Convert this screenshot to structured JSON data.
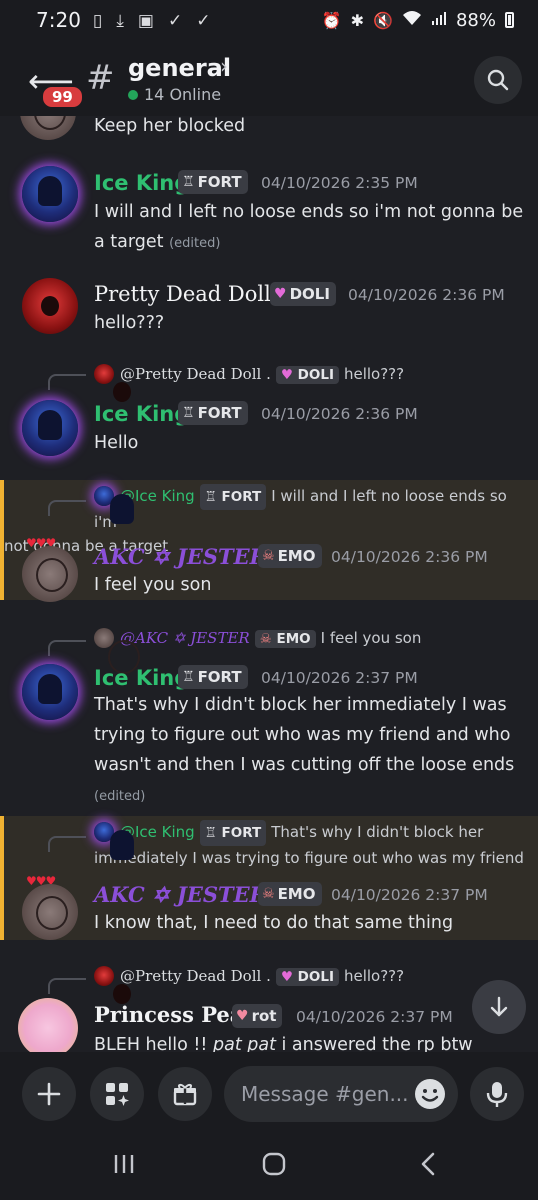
{
  "status_bar": {
    "time": "7:20",
    "battery": "88%",
    "left_icons": [
      "sim-icon",
      "download-icon",
      "image-icon",
      "check-icon",
      "check-icon"
    ],
    "right_icons": [
      "alarm-icon",
      "bluetooth-icon",
      "mute-icon",
      "wifi-icon",
      "signal-icon"
    ]
  },
  "header": {
    "unread_badge": "99",
    "channel_name": "general",
    "online": "14 Online"
  },
  "messages": [
    {
      "id": "m0",
      "text": "Keep her blocked"
    },
    {
      "id": "m1",
      "author": "Ice King",
      "tag": "FORT",
      "time": "04/10/2026 2:35 PM",
      "text": "I will and I left no loose ends so i'm not gonna be a target",
      "edited": "(edited)"
    },
    {
      "id": "m2",
      "author": "Pretty Dead Doll .",
      "tag": "DOLI",
      "time": "04/10/2026 2:36 PM",
      "text": "hello???"
    },
    {
      "id": "m3",
      "reply": {
        "author": "@Pretty Dead Doll .",
        "tag": "DOLI",
        "text": "hello???"
      },
      "author": "Ice King",
      "tag": "FORT",
      "time": "04/10/2026 2:36 PM",
      "text": "Hello"
    },
    {
      "id": "m4",
      "highlighted": true,
      "reply": {
        "author": "@Ice King",
        "tag": "FORT",
        "text_line1": "I will and I left no loose ends so i'm",
        "text_line2": "not gonna be a target"
      },
      "author": "AKC ✡ JESTER",
      "tag": "EMO",
      "time": "04/10/2026 2:36 PM",
      "text": "I feel you son"
    },
    {
      "id": "m5",
      "reply": {
        "author": "@AKC ✡ JESTER",
        "tag": "EMO",
        "text": "I feel you son"
      },
      "author": "Ice King",
      "tag": "FORT",
      "time": "04/10/2026 2:37 PM",
      "text": "That's why I didn't block her immediately I was trying to figure out who was my friend and who wasn't and then I was cutting off the loose ends",
      "edited": "(edited)"
    },
    {
      "id": "m6",
      "highlighted": true,
      "reply": {
        "author": "@Ice King",
        "tag": "FORT",
        "text_line1": "That's why I didn't block her",
        "text_line2": "immediately I was trying to figure out who was my friend"
      },
      "author": "AKC ✡ JESTER",
      "tag": "EMO",
      "time": "04/10/2026 2:37 PM",
      "text": "I know that, I need to do that same thing"
    },
    {
      "id": "m7",
      "reply": {
        "author": "@Pretty Dead Doll .",
        "tag": "DOLI",
        "text": "hello???"
      },
      "author": "Princess Peach",
      "tag": "rot",
      "time": "04/10/2026 2:37 PM",
      "text_plain1": "BLEH hello !! ",
      "text_italic": "pat pat",
      "text_plain2": " i answered the rp btw"
    }
  ],
  "composer": {
    "placeholder": "Message #gen..."
  },
  "colors": {
    "ice_king": "#2fbf71",
    "jester": "#8b4fd8",
    "highlight_bar": "#f0b232",
    "badge_red": "#d83c3e"
  }
}
